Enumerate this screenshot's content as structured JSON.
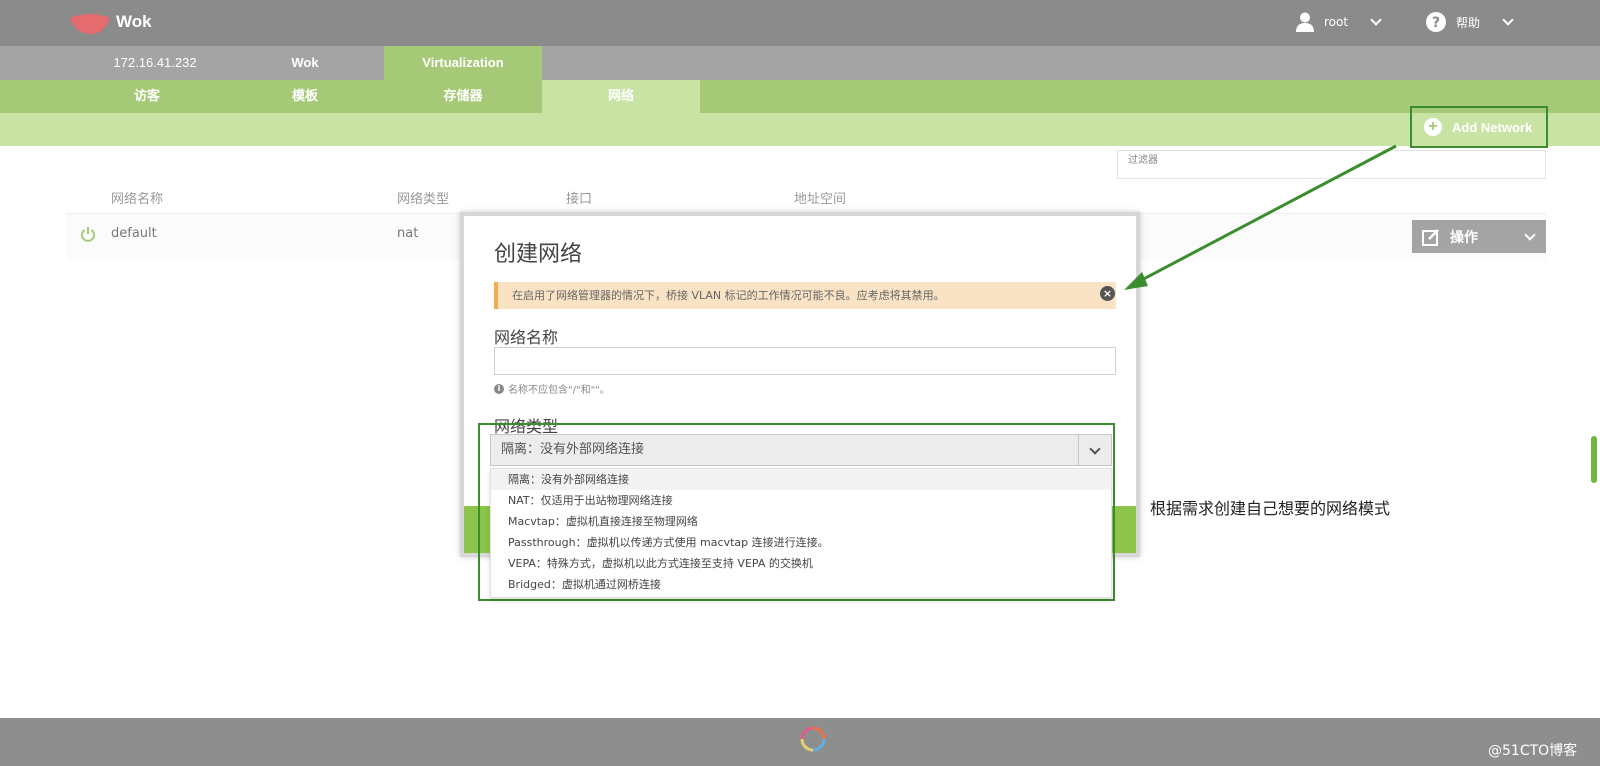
{
  "header": {
    "brand": "Wok",
    "user": "root",
    "help": "帮助"
  },
  "host_tabs": [
    "172.16.41.232",
    "Wok",
    "Virtualization"
  ],
  "sub_tabs": [
    "访客",
    "模板",
    "存储器",
    "网络"
  ],
  "toolbar": {
    "add_network": "Add Network",
    "filter_placeholder": "过滤器"
  },
  "table": {
    "columns": [
      "网络名称",
      "网络类型",
      "接口",
      "地址空间"
    ],
    "rows": [
      {
        "name": "default",
        "type": "nat",
        "action": "操作"
      }
    ]
  },
  "modal": {
    "title": "创建网络",
    "alert": "在启用了网络管理器的情况下，桥接 VLAN 标记的工作情况可能不良。应考虑将其禁用。",
    "name_label": "网络名称",
    "name_value": "",
    "name_hint": "名称不应包含\"/\"和\"\"。",
    "type_label": "网络类型",
    "type_selected": "隔离：没有外部网络连接",
    "type_options": [
      "隔离：没有外部网络连接",
      "NAT：仅适用于出站物理网络连接",
      "Macvtap：虚拟机直接连接至物理网络",
      "Passthrough：虚拟机以传递方式使用 macvtap 连接进行连接。",
      "VEPA：特殊方式，虚拟机以此方式连接至支持 VEPA 的交换机",
      "Bridged：虚拟机通过网桥连接"
    ]
  },
  "annotation": "根据需求创建自己想要的网络模式",
  "watermark": "@51CTO博客",
  "colors": {
    "header_gray": "#8b8b8b",
    "green": "#a5c977",
    "light_green": "#c9e3a4",
    "annotation_green": "#3c8d2f"
  }
}
